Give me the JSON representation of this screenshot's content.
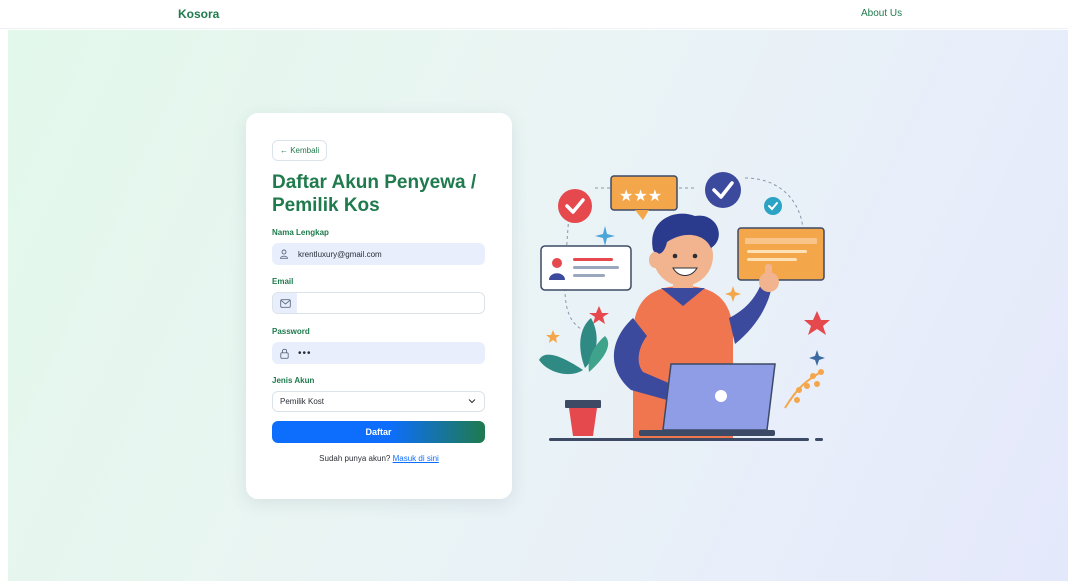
{
  "nav": {
    "brand": "Kosora",
    "about": "About Us"
  },
  "form": {
    "back_label": "← Kembali",
    "title": "Daftar Akun Penyewa / Pemilik Kos",
    "name_label": "Nama Lengkap",
    "name_value": "krentluxury@gmail.com",
    "email_label": "Email",
    "email_value": "",
    "password_label": "Password",
    "password_value": "•••",
    "account_type_label": "Jenis Akun",
    "account_type_value": "Pemilik Kost",
    "submit_label": "Daftar",
    "login_prompt": "Sudah punya akun?",
    "login_link": "Masuk di sini"
  },
  "icons": {
    "user": "user-icon",
    "email": "envelope-icon",
    "lock": "lock-icon",
    "chevron": "chevron-down-icon"
  },
  "colors": {
    "brand_green": "#1f7a4d",
    "primary_blue": "#0d6efd",
    "input_bg": "#e8eefc"
  }
}
